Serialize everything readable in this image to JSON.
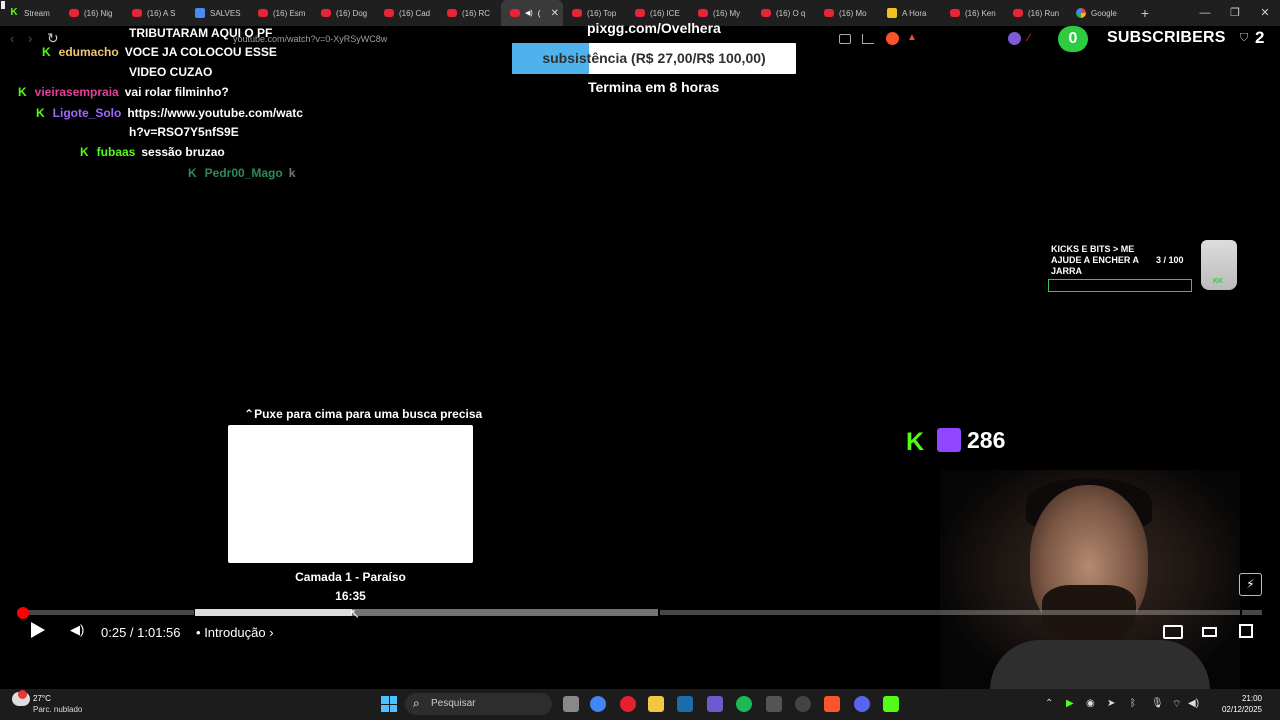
{
  "browser": {
    "tabs": [
      {
        "label": "Stream",
        "favicon": "kick-icon",
        "active": false
      },
      {
        "label": "(16) Nig",
        "favicon": "youtube-icon",
        "active": false
      },
      {
        "label": "(16) A S",
        "favicon": "youtube-icon",
        "active": false
      },
      {
        "label": "SALVES",
        "favicon": "docs-icon",
        "active": false
      },
      {
        "label": "(16) Esm",
        "favicon": "youtube-icon",
        "active": false
      },
      {
        "label": "(16) Dog",
        "favicon": "youtube-icon",
        "active": false
      },
      {
        "label": "(16) Cad",
        "favicon": "youtube-icon",
        "active": false
      },
      {
        "label": "(16) RC",
        "favicon": "youtube-icon",
        "active": false
      },
      {
        "label": "(",
        "favicon": "youtube-icon",
        "active": true
      },
      {
        "label": "(16) Top",
        "favicon": "youtube-icon",
        "active": false
      },
      {
        "label": "(16) ICE",
        "favicon": "youtube-icon",
        "active": false
      },
      {
        "label": "(16) My",
        "favicon": "youtube-icon",
        "active": false
      },
      {
        "label": "(16) O q",
        "favicon": "youtube-icon",
        "active": false
      },
      {
        "label": "(16) Mo",
        "favicon": "youtube-icon",
        "active": false
      },
      {
        "label": "A Hora",
        "favicon": "sheet-icon",
        "active": false
      },
      {
        "label": "(16) Ken",
        "favicon": "youtube-icon",
        "active": false
      },
      {
        "label": "(16) Run",
        "favicon": "youtube-icon",
        "active": false
      },
      {
        "label": "Google",
        "favicon": "google-icon",
        "active": false
      }
    ],
    "new_tab": "+",
    "url": "youtube.com/watch?v=0-XyRSyWC8w",
    "window_controls": {
      "minimize": "—",
      "restore": "❐",
      "close": "✕"
    }
  },
  "overlay": {
    "chat": [
      {
        "user": "",
        "message": "TRIBUTARAM AQUI O PF",
        "user_color": "#ffffff"
      },
      {
        "user": "edumacho",
        "message": "VOCE JA COLOCOU ESSE",
        "user_color": "#f0c674"
      },
      {
        "user": "",
        "message": "VIDEO CUZAO",
        "user_color": "#ffffff"
      },
      {
        "user": "vieirasempraia",
        "message": "vai rolar filminho?",
        "user_color": "#e0409a"
      },
      {
        "user": "Ligote_Solo",
        "message": "https://www.youtube.com/watc",
        "user_color": "#a066ff"
      },
      {
        "user": "",
        "message": "h?v=RSO7Y5nfS9E",
        "user_color": "#ffffff"
      },
      {
        "user": "fubaas",
        "message": "sessão bruzao",
        "user_color": "#53fc18"
      },
      {
        "user": "Pedr00_Mago",
        "message": "k",
        "user_color": "#2e8b57"
      }
    ],
    "goal": {
      "url": "pixgg.com/Ovelhera",
      "text": "subsistência (R$ 27,00/R$ 100,00)",
      "progress": 0.27,
      "ends": "Termina em 8 horas"
    },
    "subscribers": {
      "pill_value": "0",
      "label": "SUBSCRIBERS",
      "count": "2"
    },
    "jar": {
      "title": "KICKS E BITS > ME AJUDE A ENCHER A JARRA",
      "count": "3  / 100",
      "progress": 0.03,
      "logo": "KK"
    },
    "viewers": {
      "kick_glyph": "K",
      "count": "286"
    }
  },
  "player": {
    "pull_hint": "Puxe para cima para uma busca precisa",
    "pull_hint_icon": "⌃",
    "chapter_title": "Camada 1 - Paraíso",
    "hover_time": "16:35",
    "progress": {
      "played": 0.002,
      "hover_fill": 0.34
    },
    "time": "0:25 / 1:01:56",
    "separator": "•",
    "chapter": "Introdução",
    "chapter_arrow": "›",
    "bolt": "⚡"
  },
  "taskbar": {
    "weather_temp": "27°C",
    "weather_desc": "Parc. nublado",
    "search_placeholder": "Pesquisar",
    "time": "21:00",
    "date": "02/12/2025"
  }
}
